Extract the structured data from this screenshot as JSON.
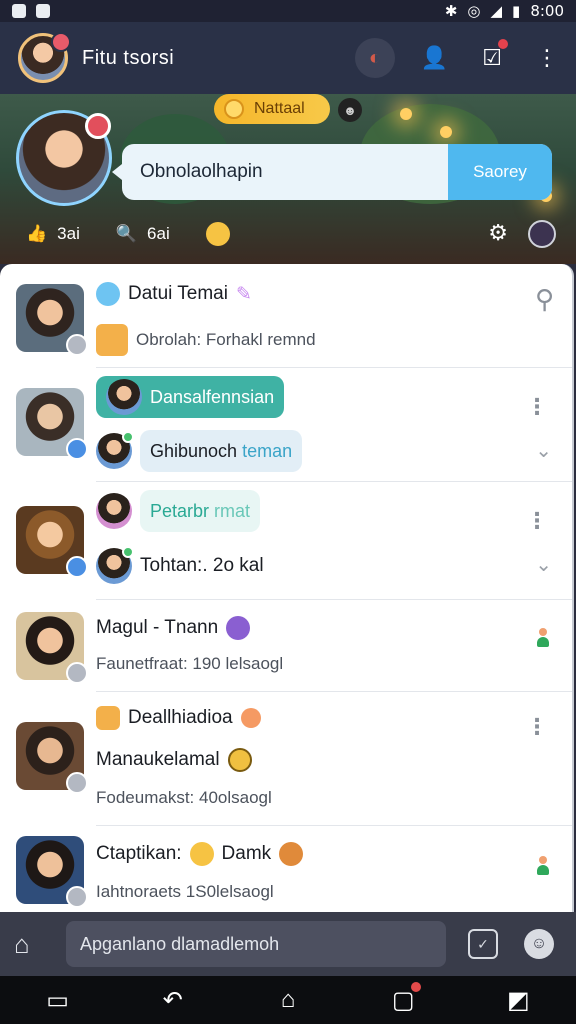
{
  "status": {
    "time": "8:00"
  },
  "header": {
    "title": "Fitu tsorsi"
  },
  "hero": {
    "pill_label": "Nattaal",
    "search_placeholder": "Obnolaolhapin",
    "search_button": "Saorey",
    "stat1": "3ai",
    "stat2": "6ai"
  },
  "chats": [
    {
      "name": "Datui Temai",
      "preview": "Obrolah: Forhakl remnd"
    },
    {
      "chip1": "Dansalfennsian",
      "chip2": "Ghibunoch",
      "chip2_tail": "teman"
    },
    {
      "chip1": "Petarbr",
      "chip1_tail": "rmat",
      "preview": "Tohtan:. 2o kal"
    },
    {
      "name": "Magul - Tnann",
      "preview": "Faunetfraat: 190 lelsaogl"
    },
    {
      "name": "Deallhiadioa",
      "name2": "Manaukelamal",
      "preview": "Fodeumakst: 40olsaogl"
    },
    {
      "name": "Ctaptikan:",
      "name_tail": "Damk",
      "preview": "Iahtnoraets 1S0lelsaogl"
    }
  ],
  "input": {
    "placeholder": "Apganlano dlamadlemoh"
  },
  "colors": {
    "accent": "#4fb8ef",
    "teal": "#3fb2a4",
    "header": "#2a3147"
  }
}
